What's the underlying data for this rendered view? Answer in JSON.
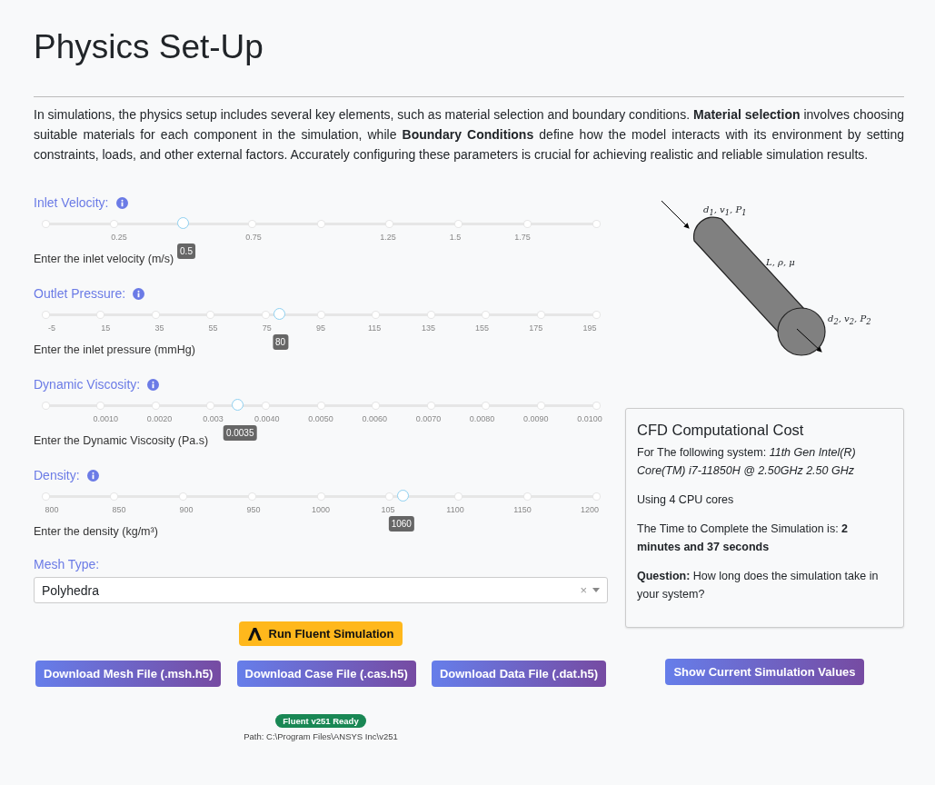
{
  "title": "Physics Set-Up",
  "intro": "In simulations, the physics setup includes several key elements, such as material selection and boundary conditions. **Material selection** involves choosing suitable materials for each component in the simulation, while **Boundary Conditions** define how the model interacts with its environment by setting constraints, loads, and other external factors. Accurately configuring these parameters is crucial for achieving realistic and reliable simulation results.",
  "sliders": [
    {
      "label": "Inlet Velocity:",
      "level": 0.25,
      "value": "0.5",
      "ticks": [
        {
          "kind": "dot"
        },
        {
          "kind": "labeled",
          "label": "0.25"
        },
        {
          "kind": "dot"
        },
        {
          "kind": "labeled",
          "label": "0.75"
        },
        {
          "kind": "dot"
        },
        {
          "kind": "labeled",
          "label": "1.25"
        },
        {
          "kind": "labeled",
          "label": "1.5"
        },
        {
          "kind": "labeled",
          "label": "1.75"
        },
        {
          "kind": "dot"
        }
      ],
      "hint": "Enter the inlet velocity (m/s)"
    },
    {
      "label": "Outlet Pressure:",
      "level": 0.425,
      "value": "80",
      "ticks": [
        {
          "kind": "labeled",
          "label": "-5"
        },
        {
          "kind": "labeled",
          "label": "15"
        },
        {
          "kind": "labeled",
          "label": "35"
        },
        {
          "kind": "labeled",
          "label": "55"
        },
        {
          "kind": "labeled",
          "label": "75"
        },
        {
          "kind": "labeled",
          "label": "95"
        },
        {
          "kind": "labeled",
          "label": "115"
        },
        {
          "kind": "labeled",
          "label": "135"
        },
        {
          "kind": "labeled",
          "label": "155"
        },
        {
          "kind": "labeled",
          "label": "175"
        },
        {
          "kind": "labeled",
          "label": "195"
        }
      ],
      "hint": "Enter the inlet pressure (mmHg)"
    },
    {
      "label": "Dynamic Viscosity:",
      "level": 0.35,
      "value": "0.0035",
      "ticks": [
        {
          "kind": "dot"
        },
        {
          "kind": "labeled",
          "label": "0.0010"
        },
        {
          "kind": "labeled",
          "label": "0.0020"
        },
        {
          "kind": "labeled",
          "label": "0.003"
        },
        {
          "kind": "labeled",
          "label": "0.0040"
        },
        {
          "kind": "labeled",
          "label": "0.0050"
        },
        {
          "kind": "labeled",
          "label": "0.0060"
        },
        {
          "kind": "labeled",
          "label": "0.0070"
        },
        {
          "kind": "labeled",
          "label": "0.0080"
        },
        {
          "kind": "labeled",
          "label": "0.0090"
        },
        {
          "kind": "labeled",
          "label": "0.0100"
        }
      ],
      "hint": "Enter the Dynamic Viscosity (Pa.s)"
    },
    {
      "label": "Density:",
      "level": 0.65,
      "value": "1060",
      "ticks": [
        {
          "kind": "labeled",
          "label": "800"
        },
        {
          "kind": "labeled",
          "label": "850"
        },
        {
          "kind": "labeled",
          "label": "900"
        },
        {
          "kind": "labeled",
          "label": "950"
        },
        {
          "kind": "labeled",
          "label": "1000"
        },
        {
          "kind": "labeled",
          "label": "105"
        },
        {
          "kind": "labeled",
          "label": "1100"
        },
        {
          "kind": "labeled",
          "label": "1150"
        },
        {
          "kind": "labeled",
          "label": "1200"
        }
      ],
      "hint": "Enter the density (kg/m³)"
    }
  ],
  "mesh_type": {
    "label": "Mesh Type:",
    "value": "Polyhedra",
    "clear": "×"
  },
  "run_button": "Run Fluent Simulation",
  "download_buttons": [
    "Download Mesh File (.msh.h5)",
    "Download Case File (.cas.h5)",
    "Download Data File (.dat.h5)"
  ],
  "status": {
    "badge": "Fluent v251 Ready",
    "path": "Path: C:\\Program Files\\ANSYS Inc\\v251"
  },
  "diagram": {
    "inlet": "d$_{1}$, v$_{1}$, P$_{1}$",
    "body": "L, ρ, μ",
    "outlet": "d$_{2}$, v$_{2}$, P$_{2}$"
  },
  "cost_card": {
    "title": "CFD Computational Cost",
    "paragraphs": [
      "For The following system: *11th Gen Intel(R) Core(TM) i7-11850H @ 2.50GHz 2.50 GHz*",
      "Using 4 CPU cores",
      "The Time to Complete the Simulation is: **2 minutes and 37 seconds**",
      "**Question:** How long does the simulation take in your system?"
    ]
  },
  "show_values_button": "Show Current Simulation Values"
}
